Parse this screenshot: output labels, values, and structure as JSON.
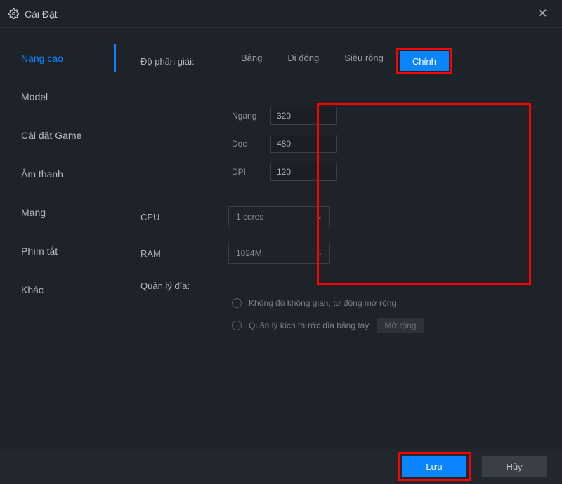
{
  "window": {
    "title": "Cài Đặt"
  },
  "sidebar": {
    "items": [
      {
        "label": "Nâng cao",
        "active": true
      },
      {
        "label": "Model"
      },
      {
        "label": "Cài đặt Game"
      },
      {
        "label": "Âm thanh"
      },
      {
        "label": "Mạng"
      },
      {
        "label": "Phím tắt"
      },
      {
        "label": "Khác"
      }
    ]
  },
  "main": {
    "resolution": {
      "label": "Độ phân giải:",
      "tabs": [
        {
          "label": "Bảng"
        },
        {
          "label": "Di động"
        },
        {
          "label": "Siêu rộng"
        },
        {
          "label": "Chỉnh",
          "active": true
        }
      ],
      "width_label": "Ngang",
      "width_value": "320",
      "height_label": "Dọc",
      "height_value": "480",
      "dpi_label": "DPI",
      "dpi_value": "120"
    },
    "cpu": {
      "label": "CPU",
      "value": "1 cores"
    },
    "ram": {
      "label": "RAM",
      "value": "1024M"
    },
    "disk": {
      "label": "Quản lý đĩa:",
      "options": [
        {
          "label": "Không đủ không gian, tự động mở rộng"
        },
        {
          "label": "Quản lý kích thước đĩa bằng tay"
        }
      ],
      "extend_label": "Mở rộng"
    }
  },
  "footer": {
    "save_label": "Lưu",
    "cancel_label": "Hủy"
  }
}
